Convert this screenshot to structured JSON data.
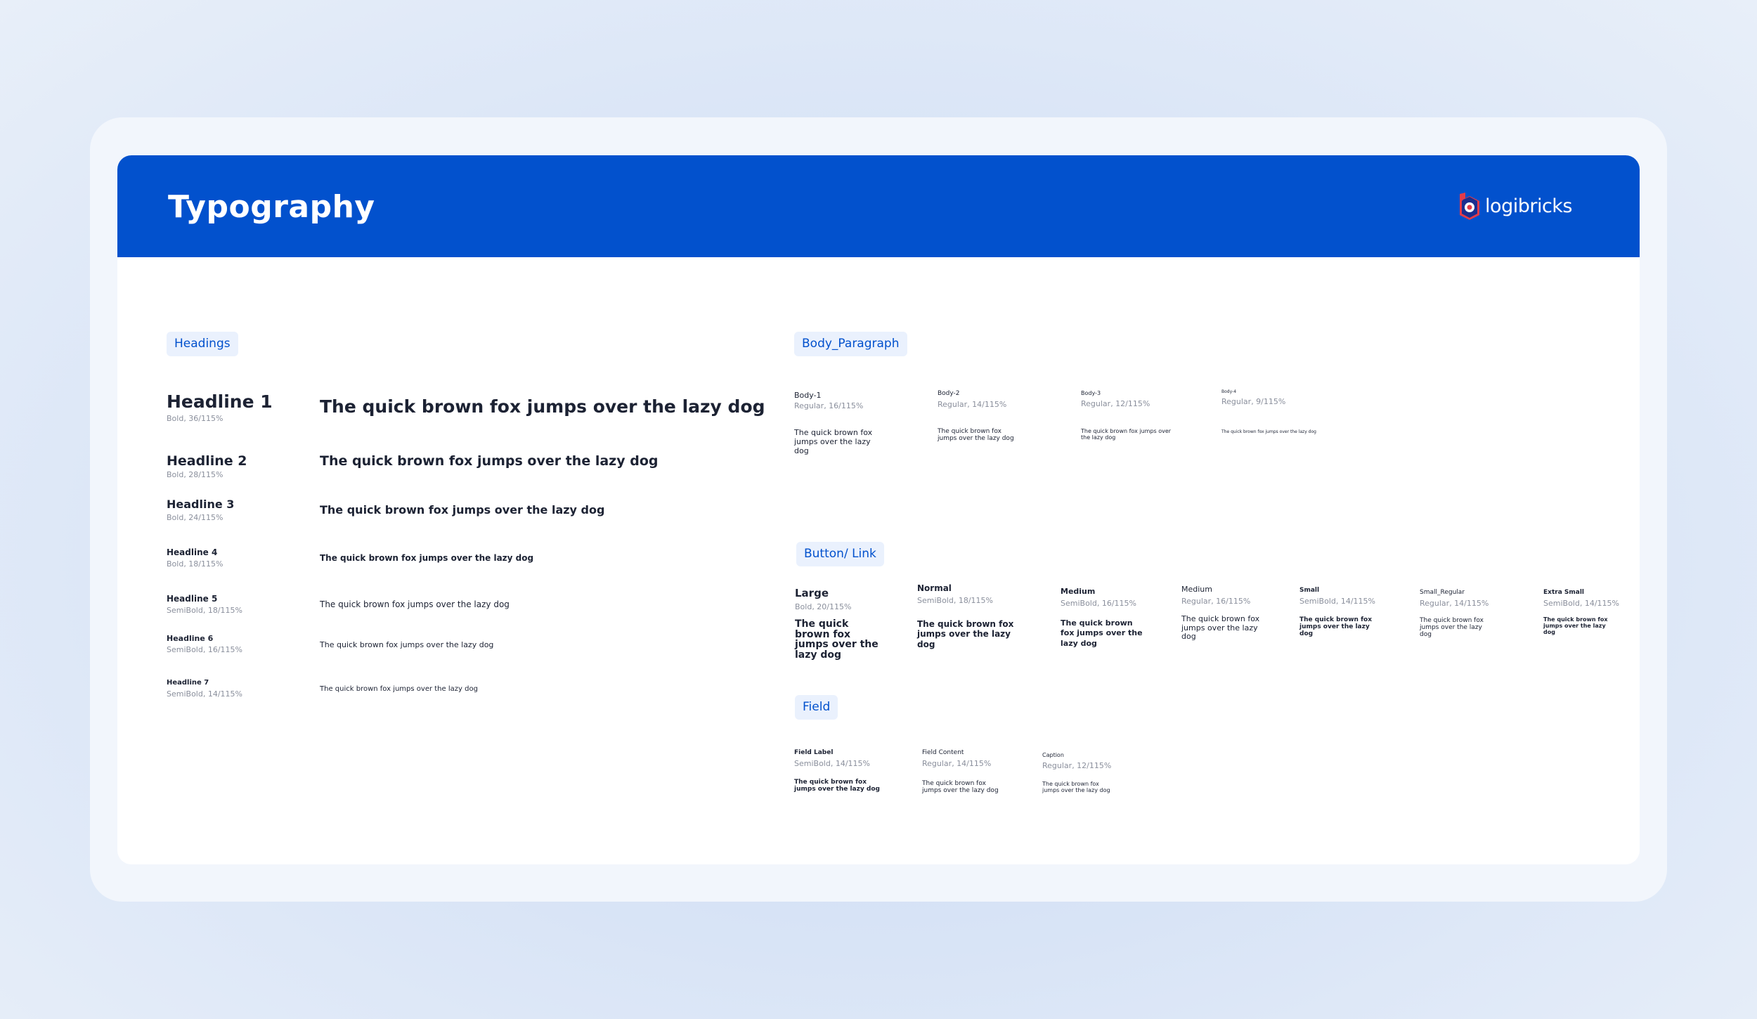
{
  "header": {
    "title": "Typography",
    "logo_text": "logibricks"
  },
  "sections": {
    "headings_label": "Headings",
    "body_label": "Body_Paragraph",
    "button_label": "Button/ Link",
    "field_label": "Field"
  },
  "sample_text": "The quick brown fox jumps over the lazy dog",
  "headings": [
    {
      "name": "Headline 1",
      "spec": "Bold, 36/115%"
    },
    {
      "name": "Headline 2",
      "spec": "Bold, 28/115%"
    },
    {
      "name": "Headline 3",
      "spec": "Bold, 24/115%"
    },
    {
      "name": "Headline 4",
      "spec": "Bold, 18/115%"
    },
    {
      "name": "Headline 5",
      "spec": "SemiBold, 18/115%"
    },
    {
      "name": "Headline 6",
      "spec": "SemiBold, 16/115%"
    },
    {
      "name": "Headline 7",
      "spec": "SemiBold, 14/115%"
    }
  ],
  "body": [
    {
      "name": "Body-1",
      "spec": "Regular, 16/115%"
    },
    {
      "name": "Body-2",
      "spec": "Regular, 14/115%"
    },
    {
      "name": "Body-3",
      "spec": "Regular, 12/115%"
    },
    {
      "name": "Body-4",
      "spec": "Regular, 9/115%"
    }
  ],
  "buttons": [
    {
      "name": "Large",
      "spec": "Bold, 20/115%"
    },
    {
      "name": "Normal",
      "spec": "SemiBold, 18/115%"
    },
    {
      "name": "Medium",
      "spec": "SemiBold, 16/115%"
    },
    {
      "name": "Medium",
      "spec": "Regular, 16/115%"
    },
    {
      "name": "Small",
      "spec": "SemiBold, 14/115%"
    },
    {
      "name": "Small_Regular",
      "spec": "Regular, 14/115%"
    },
    {
      "name": "Extra Small",
      "spec": "SemiBold, 14/115%"
    }
  ],
  "fields": [
    {
      "name": "Field Label",
      "spec": "SemiBold, 14/115%"
    },
    {
      "name": "Field Content",
      "spec": "Regular, 14/115%"
    },
    {
      "name": "Caption",
      "spec": "Regular, 12/115%"
    }
  ],
  "colors": {
    "brand_blue": "#0251cd",
    "chip_bg": "#eaf1fd",
    "text_dark": "#1c2233",
    "text_meta": "#8a8f9c"
  }
}
